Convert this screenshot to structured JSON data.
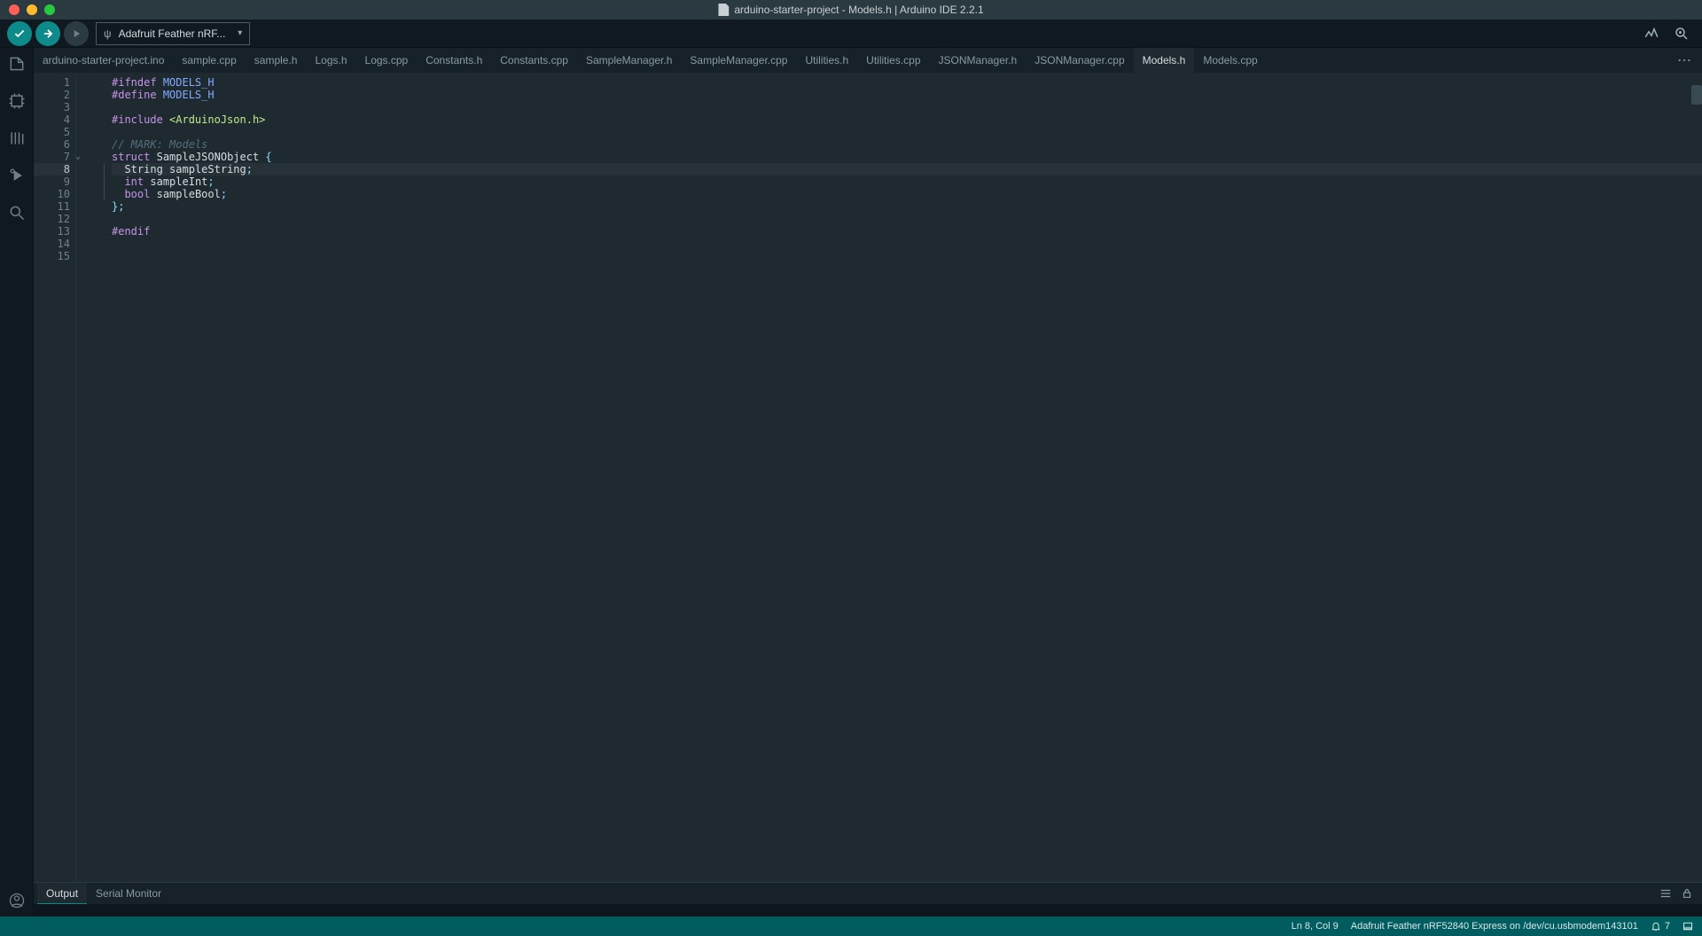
{
  "window": {
    "title": "arduino-starter-project - Models.h | Arduino IDE 2.2.1"
  },
  "toolbar": {
    "board_selector_label": "Adafruit Feather nRF...",
    "verify_tooltip": "Verify",
    "upload_tooltip": "Upload",
    "debug_tooltip": "Debug"
  },
  "tabs": [
    {
      "label": "arduino-starter-project.ino",
      "active": false
    },
    {
      "label": "sample.cpp",
      "active": false
    },
    {
      "label": "sample.h",
      "active": false
    },
    {
      "label": "Logs.h",
      "active": false
    },
    {
      "label": "Logs.cpp",
      "active": false
    },
    {
      "label": "Constants.h",
      "active": false
    },
    {
      "label": "Constants.cpp",
      "active": false
    },
    {
      "label": "SampleManager.h",
      "active": false
    },
    {
      "label": "SampleManager.cpp",
      "active": false
    },
    {
      "label": "Utilities.h",
      "active": false
    },
    {
      "label": "Utilities.cpp",
      "active": false
    },
    {
      "label": "JSONManager.h",
      "active": false
    },
    {
      "label": "JSONManager.cpp",
      "active": false
    },
    {
      "label": "Models.h",
      "active": true
    },
    {
      "label": "Models.cpp",
      "active": false
    }
  ],
  "code_lines": [
    {
      "n": 1,
      "tokens": [
        [
          "preproc",
          "#ifndef"
        ],
        [
          "plain",
          " "
        ],
        [
          "macro",
          "MODELS_H"
        ]
      ]
    },
    {
      "n": 2,
      "tokens": [
        [
          "preproc",
          "#define"
        ],
        [
          "plain",
          " "
        ],
        [
          "macro",
          "MODELS_H"
        ]
      ]
    },
    {
      "n": 3,
      "tokens": []
    },
    {
      "n": 4,
      "tokens": [
        [
          "preproc",
          "#include"
        ],
        [
          "plain",
          " "
        ],
        [
          "string",
          "<ArduinoJson.h>"
        ]
      ]
    },
    {
      "n": 5,
      "tokens": []
    },
    {
      "n": 6,
      "tokens": [
        [
          "comment",
          "// MARK: Models"
        ]
      ]
    },
    {
      "n": 7,
      "tokens": [
        [
          "kw",
          "struct"
        ],
        [
          "plain",
          " "
        ],
        [
          "ident",
          "SampleJSONObject"
        ],
        [
          "plain",
          " "
        ],
        [
          "punc",
          "{"
        ]
      ],
      "foldable": true
    },
    {
      "n": 8,
      "tokens": [
        [
          "plain",
          "  "
        ],
        [
          "ident",
          "String"
        ],
        [
          "plain",
          " "
        ],
        [
          "ident",
          "sampleString"
        ],
        [
          "punc",
          ";"
        ]
      ],
      "current": true
    },
    {
      "n": 9,
      "tokens": [
        [
          "plain",
          "  "
        ],
        [
          "type",
          "int"
        ],
        [
          "plain",
          " "
        ],
        [
          "ident",
          "sampleInt"
        ],
        [
          "punc",
          ";"
        ]
      ]
    },
    {
      "n": 10,
      "tokens": [
        [
          "plain",
          "  "
        ],
        [
          "type",
          "bool"
        ],
        [
          "plain",
          " "
        ],
        [
          "ident",
          "sampleBool"
        ],
        [
          "punc",
          ";"
        ]
      ]
    },
    {
      "n": 11,
      "tokens": [
        [
          "punc",
          "}"
        ],
        [
          "punc",
          ";"
        ]
      ]
    },
    {
      "n": 12,
      "tokens": []
    },
    {
      "n": 13,
      "tokens": [
        [
          "preproc",
          "#endif"
        ]
      ]
    },
    {
      "n": 14,
      "tokens": []
    },
    {
      "n": 15,
      "tokens": []
    }
  ],
  "panel": {
    "tabs": [
      {
        "label": "Output",
        "active": true
      },
      {
        "label": "Serial Monitor",
        "active": false
      }
    ]
  },
  "status": {
    "cursor": "Ln 8, Col 9",
    "board": "Adafruit Feather nRF52840 Express on /dev/cu.usbmodem143101",
    "notifications": "7"
  }
}
